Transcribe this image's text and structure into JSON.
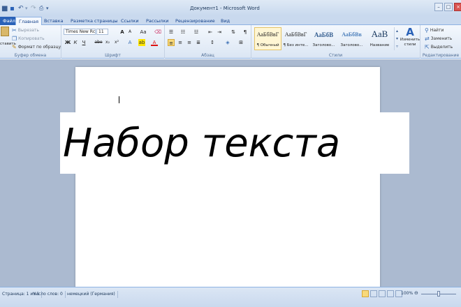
{
  "title": "Документ1 - Microsoft Word",
  "tabs": {
    "file": "Файл",
    "home": "Главная",
    "insert": "Вставка",
    "layout": "Разметка страницы",
    "refs": "Ссылки",
    "mail": "Рассылки",
    "review": "Рецензирование",
    "view": "Вид"
  },
  "clipboard": {
    "paste": "ставить",
    "cut": "Вырезать",
    "copy": "Копировать",
    "format": "Формат по образцу",
    "label": "Буфер обмена"
  },
  "font": {
    "name": "Times New Rc",
    "size": "11",
    "label": "Шрифт",
    "bold": "Ж",
    "italic": "К",
    "underline": "Ч",
    "strike": "abe",
    "sub": "x₂",
    "sup": "x²",
    "grow": "A",
    "shrink": "A",
    "case": "Aa"
  },
  "paragraph": {
    "label": "Абзац"
  },
  "styles": {
    "label": "Стили",
    "items": [
      {
        "sample": "АаБбВвГ",
        "name": "¶ Обычный"
      },
      {
        "sample": "АаБбВвГ",
        "name": "¶ Без инте..."
      },
      {
        "sample": "АаБбВ",
        "name": "Заголово..."
      },
      {
        "sample": "АаБбВв",
        "name": "Заголово..."
      },
      {
        "sample": "АаВ",
        "name": "Название"
      }
    ],
    "change": "Изменить стили"
  },
  "editing": {
    "label": "Редактирование",
    "find": "Найти",
    "replace": "Заменить",
    "select": "Выделить"
  },
  "document": {
    "text": "Набор текста"
  },
  "status": {
    "page": "Страница: 1 из 1",
    "words": "Число слов: 0",
    "lang": "немецкий (Германия)",
    "zoom": "100%"
  },
  "colors": {
    "accent": "#2a62b8",
    "canvas": "#abbad0"
  }
}
